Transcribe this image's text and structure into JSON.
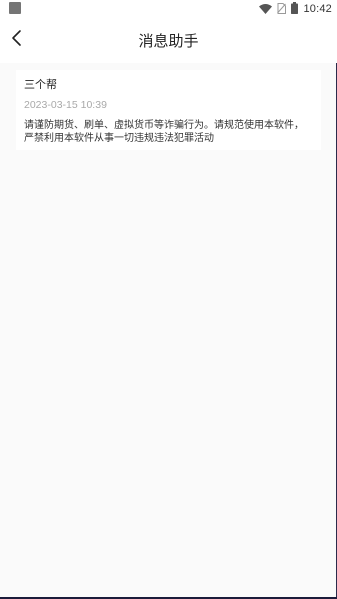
{
  "status_bar": {
    "time": "10:42",
    "icons": [
      "notification-square-icon",
      "wifi-icon",
      "no-sim-icon",
      "battery-icon"
    ]
  },
  "nav": {
    "title": "消息助手",
    "back_icon": "chevron-left-icon"
  },
  "messages": [
    {
      "sender": "三个帮",
      "time": "2023-03-15 10:39",
      "body": "请谨防期货、刷单、虚拟货币等诈骗行为。请规范使用本软件，严禁利用本软件从事一切违规违法犯罪活动"
    }
  ]
}
